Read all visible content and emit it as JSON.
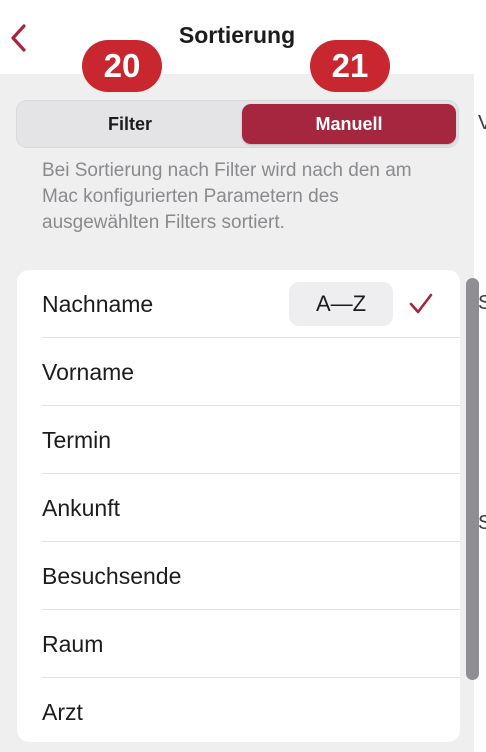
{
  "header": {
    "title": "Sortierung",
    "back_icon": "chevron-left-icon"
  },
  "badges": [
    "20",
    "21"
  ],
  "segmented_control": {
    "options": [
      "Filter",
      "Manuell"
    ],
    "selected": "Manuell"
  },
  "note": "Bei Sortierung nach Filter wird nach den am Mac konfigurierten Parametern des ausgewählten Filters sortiert.",
  "sort_options": [
    {
      "label": "Nachname",
      "order": "A—Z",
      "selected": true
    },
    {
      "label": "Vorname"
    },
    {
      "label": "Termin"
    },
    {
      "label": "Ankunft"
    },
    {
      "label": "Besuchsende"
    },
    {
      "label": "Raum"
    },
    {
      "label": "Arzt"
    }
  ],
  "edge_glyphs": [
    "V",
    "S",
    "S"
  ],
  "colors": {
    "accent": "#a62640",
    "badge": "#c8272f",
    "background": "#efeff0",
    "secondary_text": "#8a8a8e"
  }
}
